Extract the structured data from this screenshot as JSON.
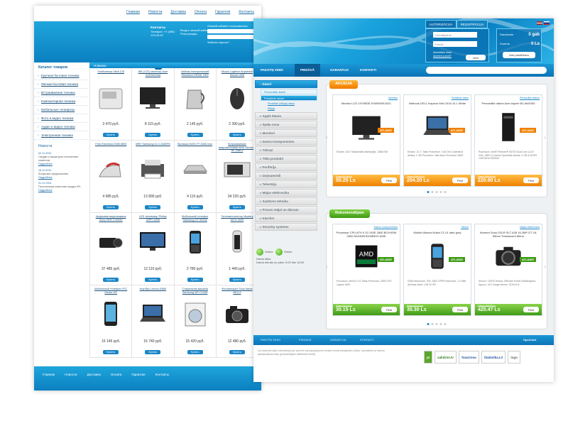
{
  "ru_site": {
    "top_links": [
      "Главная",
      "Новости",
      "Доставка",
      "Оплата",
      "Гарантия",
      "Контакты"
    ],
    "header_info": {
      "col1_title": "Контакты",
      "col1_text": [
        "Телефон: +7 (495)",
        "123-45-67"
      ],
      "col2_text": [
        "Вход в личный кабинет",
        "Регистрация"
      ],
      "login_title": "Личный кабинет пользователя",
      "login_email": "Логин",
      "login_pass": "Пароль",
      "login_links": [
        "Забыли пароль?",
        "Регистрация"
      ]
    },
    "slogan": "Интернет-магазин бытовой техники и электроники",
    "search_placeholder": "Поиск товаров",
    "catalog_title": "Каталог товаров",
    "categories": [
      "Крупная бытовая техника",
      "Мелкая бытовая техника",
      "Встраиваемая техника",
      "Компьютерная техника",
      "Мобильные телефоны",
      "Фото и видео техника",
      "Аудио и видео техника",
      "Электронная техника"
    ],
    "news_title": "Новости",
    "news": [
      {
        "date": "02.11.2011",
        "text": "Скидки и акции для постоянных клиентов.",
        "more": "Подробнее"
      },
      {
        "date": "15.11.2011",
        "text": "Бонусные предложения",
        "more": "Подробнее"
      },
      {
        "date": "01.12.2011",
        "text": "Постоянным клиентам скидка 5%",
        "more": "Подробнее"
      }
    ],
    "content_title": "Новинки",
    "buy_label": "Купить",
    "products": [
      {
        "name": "Хлебопечка Vitek 125",
        "price": "3 470 руб.",
        "icon": "breadmaker-icon"
      },
      {
        "name": "ЖК (LCD) монитор Acer V243HAObd",
        "price": "8 115 руб.",
        "icon": "monitor-icon"
      },
      {
        "name": "Чайник электрический Electrolux EEWA 7000",
        "price": "2 145 руб.",
        "icon": "kettle-icon"
      },
      {
        "name": "Мышь Logitech Anywhere Mouse USB",
        "price": "2 390 руб.",
        "icon": "mouse-icon"
      },
      {
        "name": "Утюг Electrolux EDB 8590",
        "price": "4 685 руб.",
        "icon": "iron-icon"
      },
      {
        "name": "МФУ Samsung CLX-3185FN",
        "price": "13 890 руб.",
        "icon": "printer-icon"
      },
      {
        "name": "Вытяжка KATA TF-5260 inox",
        "price": "4 110 руб.",
        "icon": "hood-icon"
      },
      {
        "name": "Встраиваемая микроволновая печь Siemens HF 24M 4",
        "price": "34 220 руб.",
        "icon": "microwave-icon"
      },
      {
        "name": "Цифровая видеокамера Sony HDR-CX500E",
        "price": "37 485 руб.",
        "icon": "camcorder-icon"
      },
      {
        "name": "LED телевизор Philips 32PFL3405",
        "price": "12 110 руб.",
        "icon": "tv-icon"
      },
      {
        "name": "Мобильный телефон Samsung GT-S5330",
        "price": "2 780 руб.",
        "icon": "phone-icon"
      },
      {
        "name": "Тепловентилятор Mystery MCH-3009",
        "price": "1 440 руб.",
        "icon": "heater-icon"
      },
      {
        "name": "Мобильный телефон HTC Desire HD",
        "price": "15 145 руб.",
        "icon": "smartphone-icon"
      },
      {
        "name": "Ноутбук Lenovo B560",
        "price": "16 740 руб.",
        "icon": "laptop-icon"
      },
      {
        "name": "Стиральная машина Samsung WF-C1008",
        "price": "15 420 руб.",
        "icon": "washer-icon"
      },
      {
        "name": "Фотоаппарат Sony Alpha NEX-5",
        "price": "12 480 руб.",
        "icon": "camera-icon"
      }
    ],
    "footer_links": [
      "Главная",
      "Новости",
      "Доставка",
      "Оплата",
      "Гарантия",
      "Контакты"
    ]
  },
  "lv_site": {
    "tabs": [
      "AUTORIZĀCIJA",
      "REĢISTRĀCIJA"
    ],
    "login": {
      "email_placeholder": "Lietotājvārds",
      "pass_placeholder": "Parole",
      "remember": "Atcerēties mani",
      "forgot": "Aizmirsi paroli?",
      "enter": "Ieiet"
    },
    "basket": {
      "title": "Daudzums",
      "count": "0",
      "sum_label": "Summa",
      "sum": "0 Ls",
      "button": "Iziet pasūtīšanu",
      "row1": "0 gab"
    },
    "nav": [
      "PAKOTŅ VEIDI",
      "PIEDĀVĀ",
      "GARANTIJA",
      "KONTAKTI"
    ],
    "sidebar": {
      "categories": [
        "Datori",
        "Apple Mania",
        "Spēļu zona",
        "Monitori",
        "Datoru komponentes",
        "Tālruņi",
        "Tīkla produkti",
        "Perifērija",
        "Izejmateriāli",
        "Televīzija",
        "Mājas elektronika",
        "Sadzīves tehnika",
        "Preces mājai un dārzam",
        "Kārcher",
        "Security systems"
      ],
      "subs": [
        "Personālie datori",
        "Portatīvie datori"
      ],
      "subsubs": [
        "Portatīvie (klēpja) datori",
        "Klēpja"
      ],
      "online": "Online",
      "online2": "Online",
      "hours_title": "Darba laiks:",
      "hours": "Darba dienās no plkst. 9:00 līdz 18:00"
    },
    "akcija_title": "AKCEIJA",
    "rekomend_title": "Rekomendējam",
    "badge_akc": "ATLAIDE",
    "buy": "Pirkt",
    "akcija_cards": [
      {
        "cat": "Monitori",
        "title": "Monitor LCD 19\"/WIDE E94WSH5 AOC",
        "desc": "Ekrāns: 18.5\" Maksimālā izšķirtspēja: 1366x768",
        "old": "Cena: 61.00 Ls",
        "price": "55.25 Ls",
        "icon": "monitor-icon"
      },
      {
        "cat": "Portatīvie dator",
        "title": "Netbook DELL Inspiron Mini 1018 10.1 White",
        "desc": "Ekrāns: 10.1\" Takts Frekvence: 1.66 GHz Operatīvā atmiņa: 1 GB Procesors: Intel Atom Processor N455",
        "old": "Cena: 226.40 Ls",
        "price": "204.20 Ls",
        "icon": "laptop-icon"
      },
      {
        "cat": "Personālie dators",
        "title": "Personālie dators Acer Aspire M1 AM1930",
        "desc": "Procesors: Intel® Pentium® E6700 Dual Core (3.20 GHz, 2MB L2 cache) Operatīvā atmiņa: 4 GB of DDR3 1333 MHz SDRAM",
        "old": "Cena: 245.10 Ls",
        "price": "220.80 Ls",
        "icon": "pc-tower-icon"
      }
    ],
    "rekom_cards": [
      {
        "cat": "Datoru komponentes",
        "title": "Processor CPU ATH II X2 240E 2800 BOX/45W 2800 AD240EHDGMBOX AMD",
        "desc": "Procesors: Athlon II X2 Takts Frekvence: 2800 CPU Ligzda: AM3",
        "old": "Cena: 33.10 Ls",
        "price": "30.15 Ls",
        "icon": "cpu-icon"
      },
      {
        "cat": "Tālruņi",
        "title": "Mobile tālrunis Nokia C1-01 dark grey",
        "desc": "GSM frekvences: 900, 1800 GPRS frekvence: 1.2 Mbit Atmiņas karte: LSB 32 GB",
        "old": "Cena: 40.10 Ls",
        "price": "35.30 Ls",
        "icon": "phone-icon"
      },
      {
        "cat": "Mājas elektronika",
        "title": "Kamera Sony DSLR SLT-A35 16.2MP DT 18-55mm Translucent Mirror",
        "desc": "Sensor: CMOS Sensor, Effective Pixels Palielinājums: Approx. 16.2 Image sensor: 23.5x15.6",
        "old": "Cena: 466.20 Ls",
        "price": "425.47 Ls",
        "icon": "dslr-icon"
      }
    ],
    "footer_nav": [
      "PAKOTŅ VEIDI",
      "PIEDĀVĀ",
      "GARANTIJA",
      "KONTAKTI",
      "OpenCart"
    ],
    "footer_text": "Lai saņemtu pilnu informāciju par precēm vai pakalpojumu cenām un/vai pieejamību, lūdzu, sazinieties ar klientu apkalpošanas daļu (pieprasītājam atbilstošā formā)",
    "logos": [
      "pi",
      "salidzini.lv",
      "TavaCena",
      "Statistika.LV",
      "logo"
    ]
  }
}
